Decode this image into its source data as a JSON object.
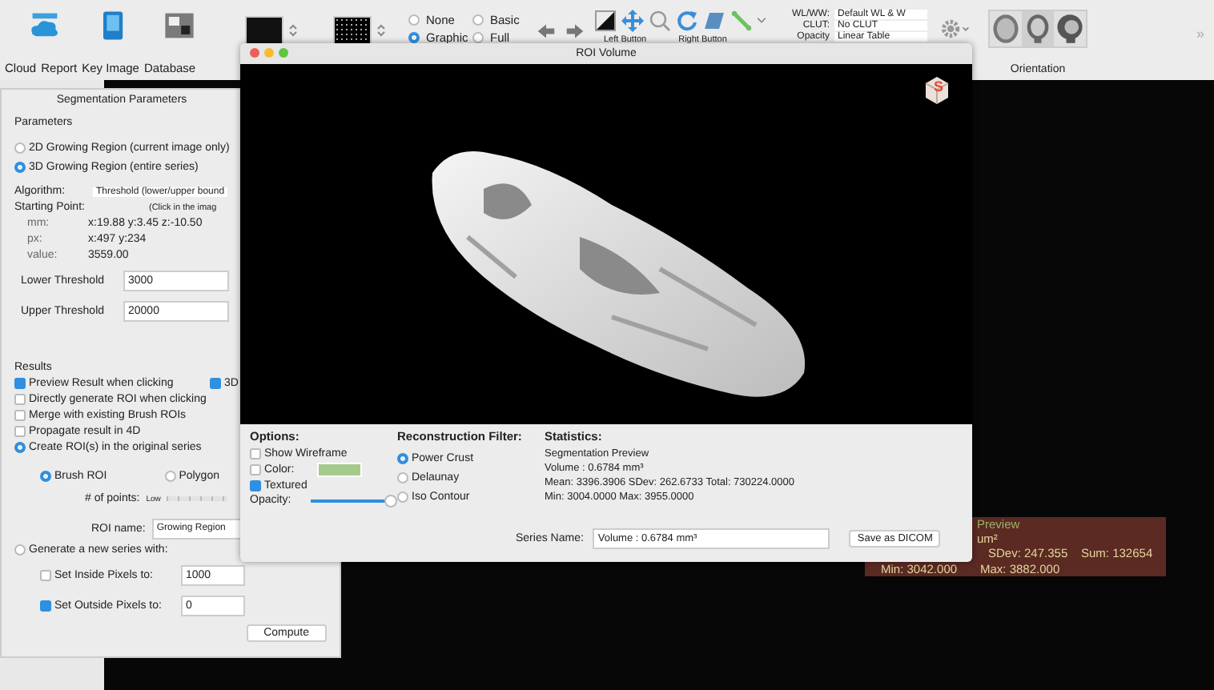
{
  "toolbar": {
    "launchers": [
      {
        "label": "Cloud"
      },
      {
        "label": "Report"
      },
      {
        "label": "Key Image"
      },
      {
        "label": "Database"
      }
    ],
    "display_modes": [
      {
        "label": "None",
        "selected": false
      },
      {
        "label": "Basic",
        "selected": false
      },
      {
        "label": "Graphic",
        "selected": true
      },
      {
        "label": "Full",
        "selected": false
      }
    ],
    "mouse_labels": [
      "Left Button",
      "Right Button"
    ],
    "wl_settings": [
      {
        "label": "WL/WW:",
        "value": "Default WL & W"
      },
      {
        "label": "CLUT:",
        "value": "No CLUT"
      },
      {
        "label": "Opacity",
        "value": "Linear Table"
      }
    ],
    "orientation_label": "Orientation",
    "overflow": "»"
  },
  "segmentation_window": {
    "title": "Segmentation Parameters",
    "parameters_heading": "Parameters",
    "modes": [
      {
        "label": "2D Growing Region (current image only)",
        "selected": false
      },
      {
        "label": "3D Growing Region (entire series)",
        "selected": true
      }
    ],
    "algorithm_label": "Algorithm:",
    "algorithm_value": "Threshold (lower/upper bound",
    "starting_point_label": "Starting Point:",
    "starting_point_hint": "(Click in the imag",
    "point_rows": [
      {
        "label": "mm:",
        "value": "x:19.88 y:3.45 z:-10.50"
      },
      {
        "label": "px:",
        "value": "x:497 y:234"
      },
      {
        "label": "value:",
        "value": "3559.00"
      }
    ],
    "thresholds": [
      {
        "label": "Lower Threshold",
        "value": "3000"
      },
      {
        "label": "Upper Threshold",
        "value": "20000"
      }
    ],
    "results_heading": "Results",
    "preview": {
      "label": "Preview Result when clicking",
      "checked": true
    },
    "preview_3d": {
      "label": "3D",
      "checked": true
    },
    "options": [
      {
        "label": "Directly generate ROI when clicking",
        "checked": false
      },
      {
        "label": "Merge with existing Brush ROIs",
        "checked": false
      },
      {
        "label": "Propagate result in 4D",
        "checked": false
      }
    ],
    "create_roi": {
      "label": "Create ROI(s) in the original series",
      "selected": true
    },
    "roi_types": [
      {
        "label": "Brush ROI",
        "selected": true
      },
      {
        "label": "Polygon",
        "selected": false
      }
    ],
    "points_label": "# of points:",
    "points_value": "Low",
    "roi_name_label": "ROI name:",
    "roi_name_value": "Growing Region",
    "generate_series": {
      "label": "Generate a new series with:",
      "selected": false
    },
    "pixel_settings": [
      {
        "label": "Set Inside Pixels to:",
        "checked": false,
        "value": "1000"
      },
      {
        "label": "Set Outside Pixels to:",
        "checked": true,
        "value": "0"
      }
    ],
    "compute_button": "Compute"
  },
  "roi_volume_window": {
    "title": "ROI Volume",
    "cube_label": "S",
    "options_heading": "Options:",
    "options": [
      {
        "label": "Show Wireframe",
        "checked": false
      },
      {
        "label": "Color:",
        "checked": false
      },
      {
        "label": "Textured",
        "checked": true
      }
    ],
    "opacity_label": "Opacity:",
    "opacity": {
      "level": 1.0
    },
    "filter_heading": "Reconstruction Filter:",
    "filters": [
      {
        "label": "Power Crust",
        "selected": true
      },
      {
        "label": "Delaunay",
        "selected": false
      },
      {
        "label": "Iso Contour",
        "selected": false
      }
    ],
    "statistics_heading": "Statistics:",
    "statistics": [
      "Segmentation Preview",
      "Volume : 0.6784 mm³",
      "Mean: 3396.3906 SDev: 262.6733 Total: 730224.0000",
      "Min: 3004.0000 Max: 3955.0000"
    ],
    "series_name_label": "Series Name:",
    "series_name_value": "Volume : 0.6784 mm³",
    "save_button": "Save as DICOM"
  },
  "viewer_overlay": {
    "title": "Preview",
    "unit": "um²",
    "sdev": "SDev: 247.355",
    "sum": "Sum: 132654",
    "min": "Min: 3042.000",
    "max": "Max: 3882.000"
  }
}
